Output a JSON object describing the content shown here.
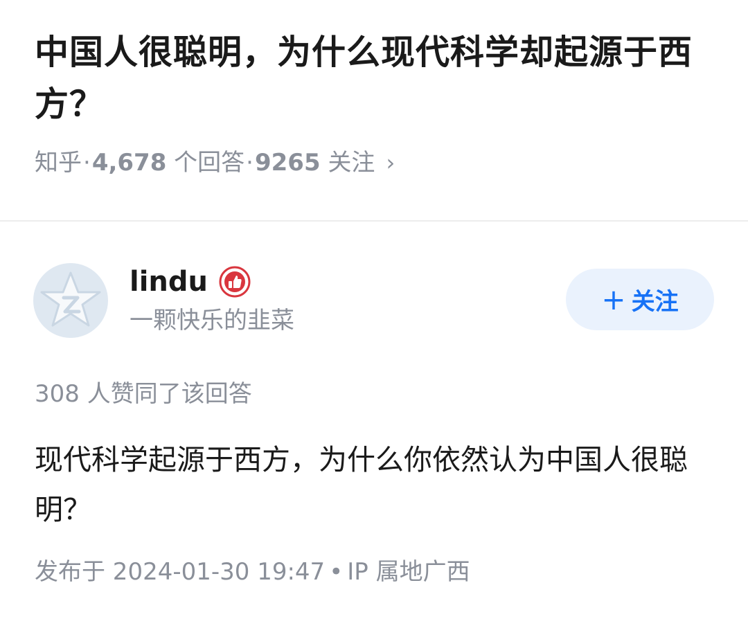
{
  "question": {
    "title": "中国人很聪明，为什么现代科学却起源于西方？",
    "source": "知乎",
    "answer_count": "4,678",
    "answer_label": "个回答",
    "follower_count": "9265",
    "follower_label": "关注",
    "separator": "·",
    "chevron": "›"
  },
  "author": {
    "name": "lindu",
    "bio": "一颗快乐的韭菜",
    "avatar_icon": "qq-star-icon",
    "badge_icon": "thumbs-up-badge-icon",
    "follow_plus": "+",
    "follow_label": "关注"
  },
  "answer": {
    "votes_text": "308 人赞同了该回答",
    "body": "现代科学起源于西方，为什么你依然认为中国人很聪明？",
    "publish_text": "发布于 2024-01-30 19:47",
    "dot": "•",
    "ip_text": "IP 属地广西"
  },
  "colors": {
    "accent": "#1772f6",
    "follow_bg": "#eaf2fd",
    "meta_text": "#8a8f99",
    "badge_red": "#d9363e"
  }
}
